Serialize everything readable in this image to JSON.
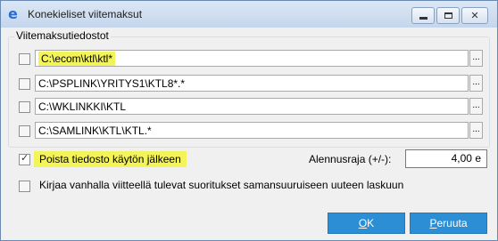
{
  "window": {
    "title": "Konekieliset viitemaksut"
  },
  "group": {
    "legend": "Viitemaksutiedostot",
    "paths": [
      {
        "value": "C:\\ecom\\ktl\\ktl*",
        "checked": false,
        "highlighted": true
      },
      {
        "value": "C:\\PSPLINK\\YRITYS1\\KTL8*.*",
        "checked": false,
        "highlighted": false
      },
      {
        "value": "C:\\WKLINKKI\\KTL",
        "checked": false,
        "highlighted": false
      },
      {
        "value": "C:\\SAMLINK\\KTL\\KTL.*",
        "checked": false,
        "highlighted": false
      }
    ],
    "browse_label": "..."
  },
  "options": {
    "delete_after_use": {
      "label": "Poista tiedosto käytön jälkeen",
      "checked": true
    },
    "record_old_ref": {
      "label": "Kirjaa vanhalla viitteellä tulevat suoritukset samansuuruiseen uuteen laskuun",
      "checked": false
    }
  },
  "discount": {
    "label": "Alennusraja (+/-):",
    "value": "4,00 e"
  },
  "buttons": {
    "ok_label": "OK",
    "ok_mnemonic": "O",
    "ok_rest": "K",
    "cancel_label": "Peruuta",
    "cancel_mnemonic": "P",
    "cancel_rest": "eruuta"
  },
  "colors": {
    "highlight": "#f3f35a",
    "button": "#2c8fd6",
    "accent_icon": "#2a6fcf"
  }
}
